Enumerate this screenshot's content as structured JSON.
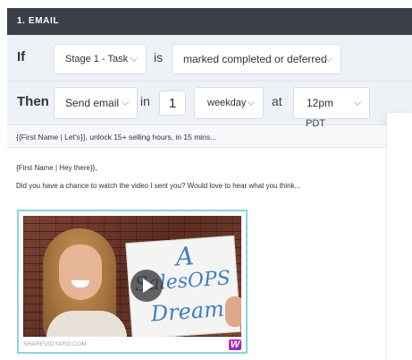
{
  "header": {
    "title": "1. EMAIL"
  },
  "if_row": {
    "keyword": "If",
    "stage_select": "Stage 1 - Task",
    "joiner": "is",
    "status_select": "marked completed or deferred"
  },
  "then_row": {
    "keyword": "Then",
    "action_select": "Send email",
    "joiner_in": "in",
    "delay_value": "1",
    "unit_select": "weekday",
    "joiner_at": "at",
    "time_select": "12pm",
    "timezone": "PDT"
  },
  "email": {
    "subject": "{{First Name | Let's}}, unlock 15+ selling hours, in 15 mins...",
    "greeting": "{First Name | Hey there}},",
    "message": "Did you have a chance to watch the video I sent you? Would love to hear what you think...",
    "video": {
      "board_line1": "A",
      "board_line2": "SalesOPS",
      "board_line3": "Dream!",
      "source": "SHAREVIDYARD.COM",
      "brand_glyph": "W"
    }
  },
  "colors": {
    "header_bg": "#3b4048",
    "row_bg": "#eef2f6",
    "video_border": "#8fd3dc",
    "board_text": "#3f7fc1"
  }
}
